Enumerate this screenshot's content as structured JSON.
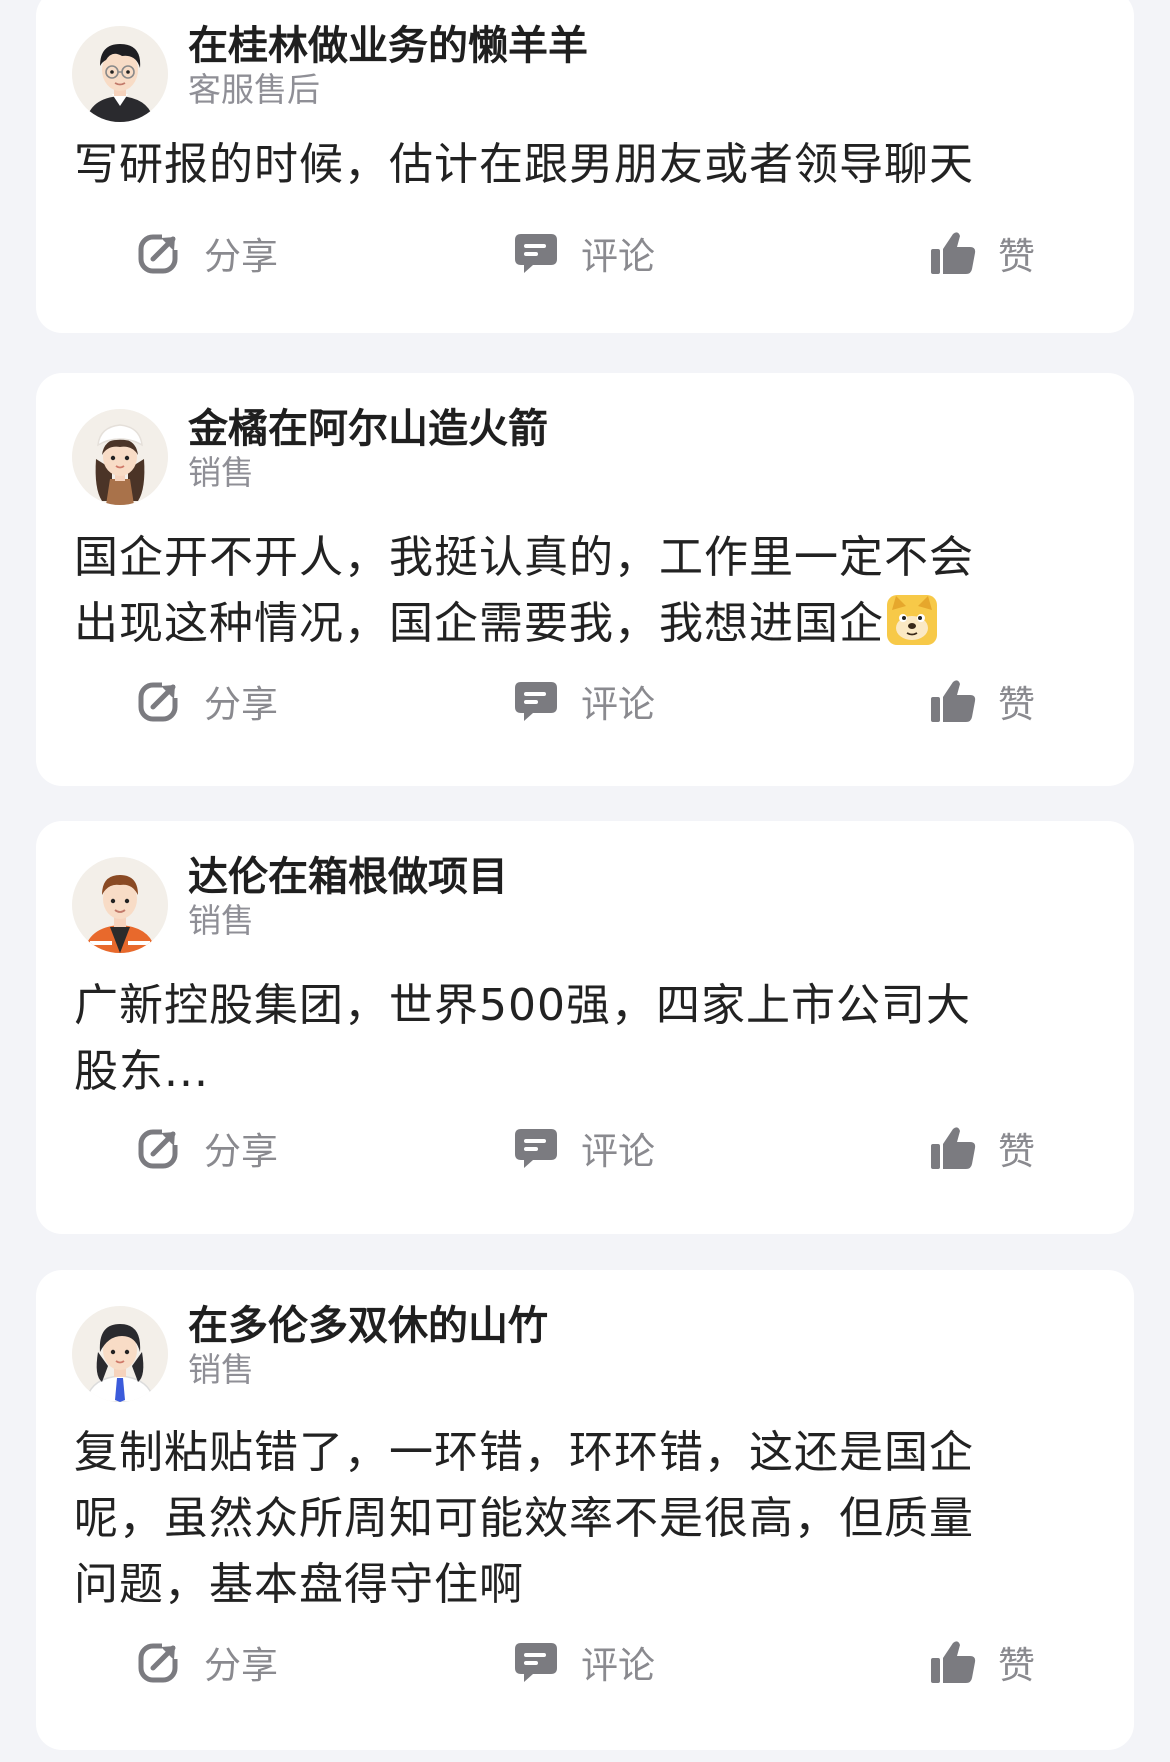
{
  "posts": [
    {
      "user_name": "在桂林做业务的懒羊羊",
      "user_role": "客服售后",
      "avatar_icon": "man-glasses-avatar",
      "content_lines": [
        "写研报的时候，估计在跟男朋友或者领导聊天"
      ],
      "actions": {
        "share_label": "分享",
        "comment_label": "评论",
        "like_label": "赞"
      }
    },
    {
      "user_name": "金橘在阿尔山造火箭",
      "user_role": "销售",
      "avatar_icon": "girl-hat-avatar",
      "content_lines": [
        "国企开不开人，我挺认真的，工作里一定不会",
        "出现这种情况，国企需要我，我想进国企"
      ],
      "trailing_emoji": "doge-emoji",
      "actions": {
        "share_label": "分享",
        "comment_label": "评论",
        "like_label": "赞"
      }
    },
    {
      "user_name": "达伦在箱根做项目",
      "user_role": "销售",
      "avatar_icon": "worker-orange-jacket-avatar",
      "content_lines": [
        "广新控股集团，世界500强，四家上市公司大",
        "股东..."
      ],
      "actions": {
        "share_label": "分享",
        "comment_label": "评论",
        "like_label": "赞"
      }
    },
    {
      "user_name": "在多伦多双休的山竹",
      "user_role": "销售",
      "avatar_icon": "woman-suit-avatar",
      "content_lines": [
        "复制粘贴错了，一环错，环环错，这还是国企",
        "呢，虽然众所周知可能效率不是很高，但质量",
        "问题，基本盘得守住啊"
      ],
      "actions": {
        "share_label": "分享",
        "comment_label": "评论",
        "like_label": "赞"
      }
    }
  ],
  "colors": {
    "background": "#f3f4f8",
    "card": "#ffffff",
    "name_text": "#1f1f1f",
    "role_text": "#8f8f96",
    "content_text": "#222222",
    "action_icon": "#7b7b80",
    "action_text": "#8a8a8f"
  }
}
